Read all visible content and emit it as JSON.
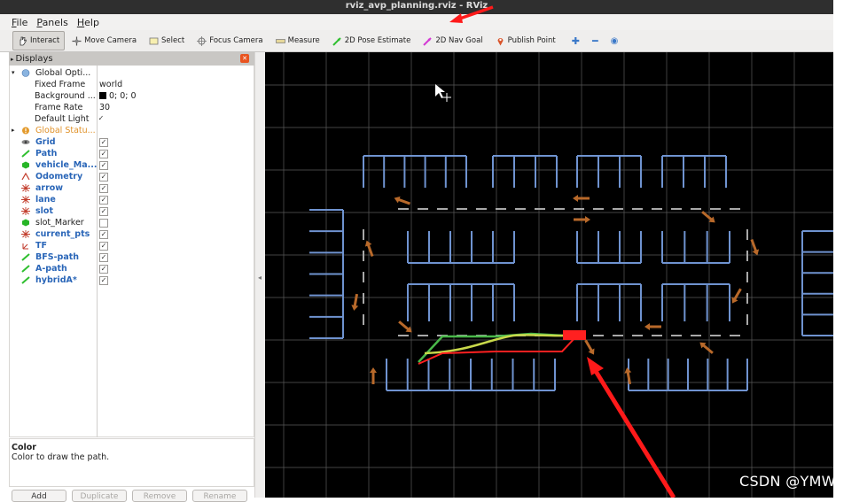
{
  "window": {
    "title": "rviz_avp_planning.rviz - RViz"
  },
  "menu": [
    "File",
    "Panels",
    "Help"
  ],
  "toolbar": [
    {
      "label": "Interact",
      "icon": "hand-icon",
      "active": true
    },
    {
      "label": "Move Camera",
      "icon": "move-camera-icon"
    },
    {
      "label": "Select",
      "icon": "select-box-icon"
    },
    {
      "label": "Focus Camera",
      "icon": "focus-crosshair-icon"
    },
    {
      "label": "Measure",
      "icon": "ruler-icon"
    },
    {
      "label": "2D Pose Estimate",
      "icon": "green-arrow-icon"
    },
    {
      "label": "2D Nav Goal",
      "icon": "pink-arrow-icon"
    },
    {
      "label": "Publish Point",
      "icon": "map-pin-icon"
    }
  ],
  "displays": {
    "title": "Displays",
    "global_options": {
      "label": "Global Opti...",
      "fixed_frame": {
        "name": "Fixed Frame",
        "value": "world"
      },
      "background": {
        "name": "Background ...",
        "value": "0; 0; 0"
      },
      "frame_rate": {
        "name": "Frame Rate",
        "value": "30"
      },
      "default_light": {
        "name": "Default Light",
        "checked": true
      }
    },
    "global_status": "Global Statu...",
    "items": [
      {
        "label": "Grid",
        "checked": true,
        "icon": "grid-icon",
        "style": "blue"
      },
      {
        "label": "Path",
        "checked": true,
        "icon": "path-icon",
        "style": "blue"
      },
      {
        "label": "vehicle_Ma...",
        "checked": true,
        "icon": "marker-cube-icon",
        "style": "blue"
      },
      {
        "label": "Odometry",
        "checked": true,
        "icon": "odometry-icon",
        "style": "blue"
      },
      {
        "label": "arrow",
        "checked": true,
        "icon": "marker-array-icon",
        "style": "blue"
      },
      {
        "label": "lane",
        "checked": true,
        "icon": "marker-array-icon",
        "style": "blue"
      },
      {
        "label": "slot",
        "checked": true,
        "icon": "marker-array-icon",
        "style": "blue"
      },
      {
        "label": "slot_Marker",
        "checked": false,
        "icon": "marker-cube-icon",
        "style": "plain"
      },
      {
        "label": "current_pts",
        "checked": true,
        "icon": "marker-array-icon",
        "style": "blue"
      },
      {
        "label": "TF",
        "checked": true,
        "icon": "tf-icon",
        "style": "blue"
      },
      {
        "label": "BFS-path",
        "checked": true,
        "icon": "path-icon",
        "style": "blue"
      },
      {
        "label": "A-path",
        "checked": true,
        "icon": "path-icon",
        "style": "blue"
      },
      {
        "label": "hybridA*",
        "checked": true,
        "icon": "path-icon",
        "style": "blue"
      }
    ],
    "description": {
      "title": "Color",
      "text": "Color to draw the path."
    },
    "buttons": [
      "Add",
      "Duplicate",
      "Remove",
      "Rename"
    ]
  },
  "colors": {
    "slot_lines": "#6f93d0",
    "arrows": "#b8692a",
    "lane_dashes": "#a8a8a8",
    "grid": "#5a5a5a",
    "astar_path": "#c8d84a",
    "bfs_path": "#4ab84a",
    "hybrid_path": "#ff2020",
    "annotation": "#ff1a1a"
  },
  "watermark": "CSDN @YMWM_"
}
